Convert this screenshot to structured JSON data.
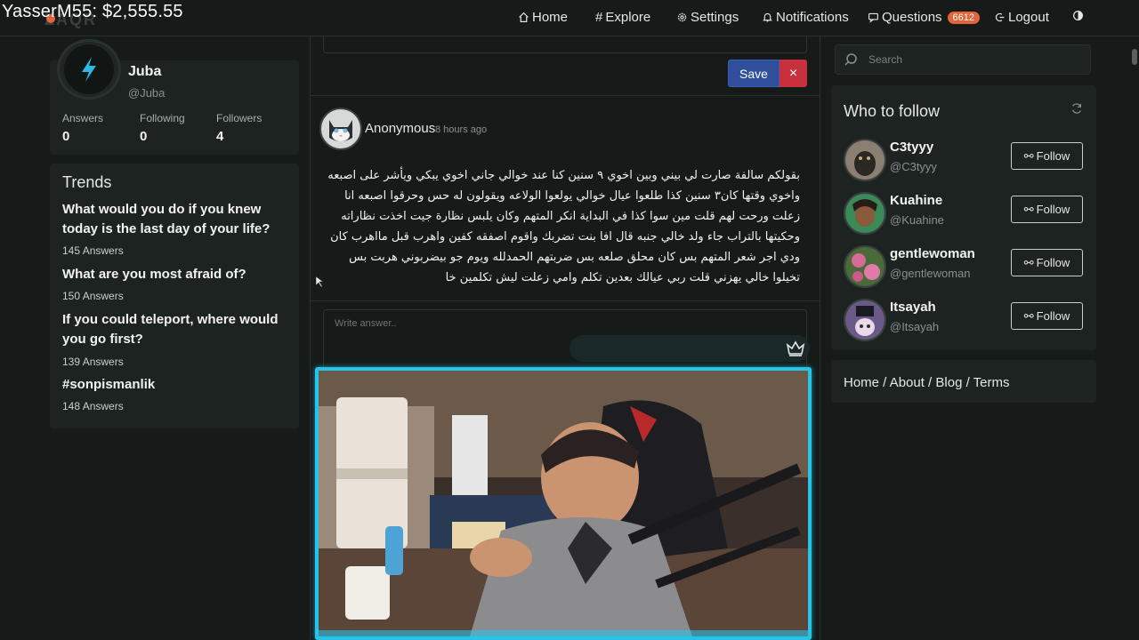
{
  "overlay": {
    "title": "YasserM55: $2,555.55"
  },
  "nav": {
    "home": "Home",
    "explore": "Explore",
    "settings": "Settings",
    "notifications": "Notifications",
    "questions": "Questions",
    "questions_count": "6612",
    "logout": "Logout"
  },
  "profile": {
    "name": "Juba",
    "handle": "@Juba",
    "answers_label": "Answers",
    "answers": "0",
    "following_label": "Following",
    "following": "0",
    "followers_label": "Followers",
    "followers": "4"
  },
  "trends": {
    "title": "Trends",
    "items": [
      {
        "question": "What would you do if you knew today is the last day of your life?",
        "answers": "145 Answers"
      },
      {
        "question": "What are you most afraid of?",
        "answers": "150 Answers"
      },
      {
        "question": "If you could teleport, where would you go first?",
        "answers": "139 Answers"
      },
      {
        "question": "#sonpismanlik",
        "answers": "148 Answers"
      }
    ]
  },
  "editor": {
    "save": "Save",
    "close": "×"
  },
  "post": {
    "author": "Anonymous",
    "time": "8 hours ago",
    "body": "بقولكم سالفة صارت لي بيني وبين اخوي ٩ سنين كنا عند خوالي جاني اخوي يبكي ويأشر على اصبعه واخوي وقتها كان٣ سنين كذا طلعوا عيال خوالي يولعوا الولاعه ويقولون له حس وحرقوا اصبعه انا زعلت ورحت لهم قلت مين سوا كذا في البداية انكر المتهم وكان يلبس نظارة جيت اخذت نظاراته وحكيتها بالتراب جاء ولد خالي جنبه قال افا بنت تضربك واقوم اصفقه كفين واهرب قبل مااهرب كان ودي اجر شعر المتهم بس كان محلق صلعه بس ضربتهم الحمدلله ويوم جو بيضربوني هربت بس تخيلوا خالي يهزني قلت ربي عيالك بعدين تكلم وامي زعلت ليش تكلمين خا"
  },
  "answer": {
    "placeholder": "Write answer.."
  },
  "search": {
    "placeholder": "Search"
  },
  "who_to_follow": {
    "title": "Who to follow",
    "follow_label": "Follow",
    "users": [
      {
        "name": "C3tyyy",
        "handle": "@C3tyyy"
      },
      {
        "name": "Kuahine",
        "handle": "@Kuahine"
      },
      {
        "name": "gentlewoman",
        "handle": "@gentlewoman"
      },
      {
        "name": "Itsayah",
        "handle": "@Itsayah"
      }
    ]
  },
  "footer": {
    "links": "Home / About / Blog / Terms"
  },
  "colors": {
    "background": "#161b19",
    "card": "#1c2321",
    "accent": "#e2643b",
    "save": "#2f4f9a",
    "close": "#c9303e",
    "video_border": "#27c4ea"
  }
}
